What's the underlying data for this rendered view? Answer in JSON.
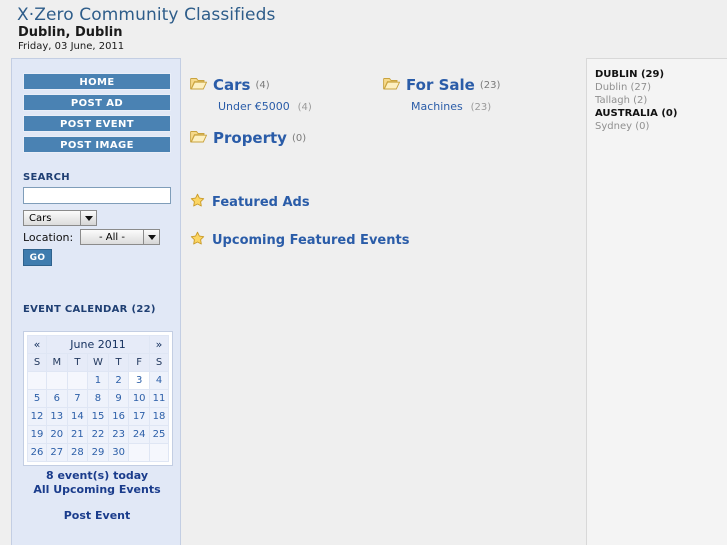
{
  "header": {
    "title": "X·Zero Community Classifieds",
    "location": "Dublin, Dublin",
    "date": "Friday, 03 June, 2011"
  },
  "sidebar": {
    "nav": [
      {
        "label": "HOME"
      },
      {
        "label": "POST AD"
      },
      {
        "label": "POST EVENT"
      },
      {
        "label": "POST IMAGE"
      }
    ],
    "search": {
      "heading": "SEARCH",
      "query_value": "",
      "query_placeholder": "",
      "category_selected": "Cars",
      "location_label": "Location:",
      "location_selected": "- All -",
      "go_label": "GO"
    },
    "calendar": {
      "heading": "EVENT CALENDAR (22)",
      "prev_label": "«",
      "next_label": "»",
      "month_title": "June 2011",
      "dow": [
        "S",
        "M",
        "T",
        "W",
        "T",
        "F",
        "S"
      ],
      "weeks": [
        [
          "",
          "",
          "",
          "1",
          "2",
          "3",
          "4"
        ],
        [
          "5",
          "6",
          "7",
          "8",
          "9",
          "10",
          "11"
        ],
        [
          "12",
          "13",
          "14",
          "15",
          "16",
          "17",
          "18"
        ],
        [
          "19",
          "20",
          "21",
          "22",
          "23",
          "24",
          "25"
        ],
        [
          "26",
          "27",
          "28",
          "29",
          "30",
          "",
          ""
        ]
      ],
      "today": "3",
      "events_today": "8 event(s) today",
      "all_events": "All Upcoming Events",
      "post_event": "Post Event"
    }
  },
  "main": {
    "categories": [
      {
        "name": "Cars",
        "count": "(4)",
        "icon": "folder-icon",
        "sub": [
          {
            "name": "Under €5000",
            "count": "(4)"
          }
        ]
      },
      {
        "name": "For Sale",
        "count": "(23)",
        "icon": "folder-icon",
        "sub": [
          {
            "name": "Machines",
            "count": "(23)"
          }
        ]
      },
      {
        "name": "Property",
        "count": "(0)",
        "icon": "folder-icon",
        "sub": []
      }
    ],
    "features": [
      {
        "name": "Featured Ads",
        "icon": "star-icon"
      },
      {
        "name": "Upcoming Featured Events",
        "icon": "star-icon"
      }
    ]
  },
  "right_panel": {
    "locations": [
      {
        "label": "DUBLIN (29)",
        "type": "country"
      },
      {
        "label": "Dublin (27)",
        "type": "city"
      },
      {
        "label": "Tallagh (2)",
        "type": "city"
      },
      {
        "label": "AUSTRALIA (0)",
        "type": "country"
      },
      {
        "label": "Sydney (0)",
        "type": "city"
      }
    ]
  },
  "colors": {
    "nav_blue": "#4a82b3",
    "link_blue": "#2a5ca8",
    "sidebar_bg": "#e1e8f6",
    "page_bg": "#efefef"
  }
}
